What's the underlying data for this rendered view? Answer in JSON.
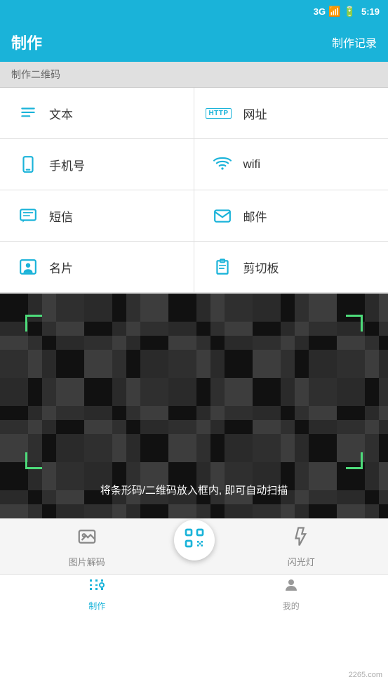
{
  "statusBar": {
    "signal": "3G",
    "time": "5:19"
  },
  "header": {
    "title": "制作",
    "action": "制作记录"
  },
  "sectionLabel": "制作二维码",
  "menuItems": [
    {
      "id": "text",
      "icon": "text-icon",
      "label": "文本",
      "side": "left"
    },
    {
      "id": "url",
      "icon": "http-icon",
      "label": "网址",
      "side": "right",
      "badge": "HTTP"
    },
    {
      "id": "phone",
      "icon": "phone-icon",
      "label": "手机号",
      "side": "left"
    },
    {
      "id": "wifi",
      "icon": "wifi-icon",
      "label": "wifi",
      "side": "right"
    },
    {
      "id": "sms",
      "icon": "sms-icon",
      "label": "短信",
      "side": "left"
    },
    {
      "id": "email",
      "icon": "email-icon",
      "label": "邮件",
      "side": "right"
    },
    {
      "id": "contact",
      "icon": "contact-icon",
      "label": "名片",
      "side": "left"
    },
    {
      "id": "clipboard",
      "icon": "clipboard-icon",
      "label": "剪切板",
      "side": "right"
    }
  ],
  "scanner": {
    "hint": "将条形码/二维码放入框内, 即可自动扫描"
  },
  "toolbar": {
    "photoLabel": "图片解码",
    "flashLabel": "闪光灯"
  },
  "bottomNav": {
    "items": [
      {
        "id": "make",
        "label": "制作",
        "active": true
      },
      {
        "id": "my",
        "label": "我的",
        "active": false
      }
    ]
  },
  "watermark": "2265.com"
}
